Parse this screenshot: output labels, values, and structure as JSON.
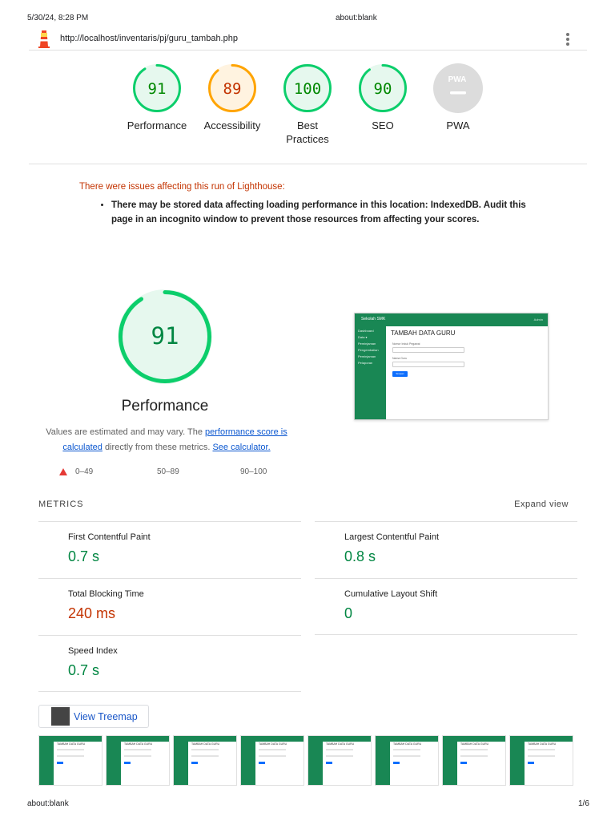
{
  "print_header": {
    "date": "5/30/24, 8:28 PM",
    "title": "about:blank"
  },
  "url": "http://localhost/inventaris/pj/guru_tambah.php",
  "gauges": [
    {
      "label": "Performance",
      "score": "91",
      "value": 0.91,
      "color": "#0cce6b",
      "bg": "#e6f8ee",
      "text_color": "#008800"
    },
    {
      "label": "Accessibility",
      "score": "89",
      "value": 0.89,
      "color": "#ffa400",
      "bg": "#fff3e0",
      "text_color": "#c33300"
    },
    {
      "label": "Best Practices",
      "score": "100",
      "value": 1.0,
      "color": "#0cce6b",
      "bg": "#e6f8ee",
      "text_color": "#008800"
    },
    {
      "label": "SEO",
      "score": "90",
      "value": 0.9,
      "color": "#0cce6b",
      "bg": "#e6f8ee",
      "text_color": "#008800"
    },
    {
      "label": "PWA",
      "badge": "PWA",
      "color": "#dcdcdc"
    }
  ],
  "warning": {
    "title": "There were issues affecting this run of Lighthouse:",
    "items": [
      "There may be stored data affecting loading performance in this location: IndexedDB. Audit this page in an incognito window to prevent those resources from affecting your scores."
    ]
  },
  "performance": {
    "score": "91",
    "value": 0.91,
    "title": "Performance",
    "desc_prefix": "Values are estimated and may vary. The ",
    "desc_link1": "performance score is calculated",
    "desc_middle": " directly from these metrics. ",
    "desc_link2": "See calculator."
  },
  "legend": {
    "fail": "0–49",
    "average": "50–89",
    "pass": "90–100"
  },
  "screenshot": {
    "brand": "Sekolah SMK",
    "top_right": "Admin",
    "sidebar": [
      "Dashboard",
      "Data ▾",
      "Peminjaman",
      "Pengembalian",
      "Peminjaman",
      "Pelaporan"
    ],
    "heading": "TAMBAH DATA GURU",
    "field1_label": "Nomor Induk Pegawai",
    "field2_label": "Nama Guru",
    "button": "Simpan"
  },
  "metrics": {
    "title": "METRICS",
    "expand": "Expand view",
    "items": [
      {
        "name": "First Contentful Paint",
        "value": "0.7 s",
        "status": "pass"
      },
      {
        "name": "Largest Contentful Paint",
        "value": "0.8 s",
        "status": "pass"
      },
      {
        "name": "Total Blocking Time",
        "value": "240 ms",
        "status": "fail"
      },
      {
        "name": "Cumulative Layout Shift",
        "value": "0",
        "status": "pass"
      },
      {
        "name": "Speed Index",
        "value": "0.7 s",
        "status": "pass"
      }
    ]
  },
  "treemap": {
    "label": "View Treemap"
  },
  "filmstrip": {
    "frame_count": 8,
    "frame_heading": "TAMBAH DATA GURU"
  },
  "print_footer": {
    "left": "about:blank",
    "right": "1/6"
  }
}
